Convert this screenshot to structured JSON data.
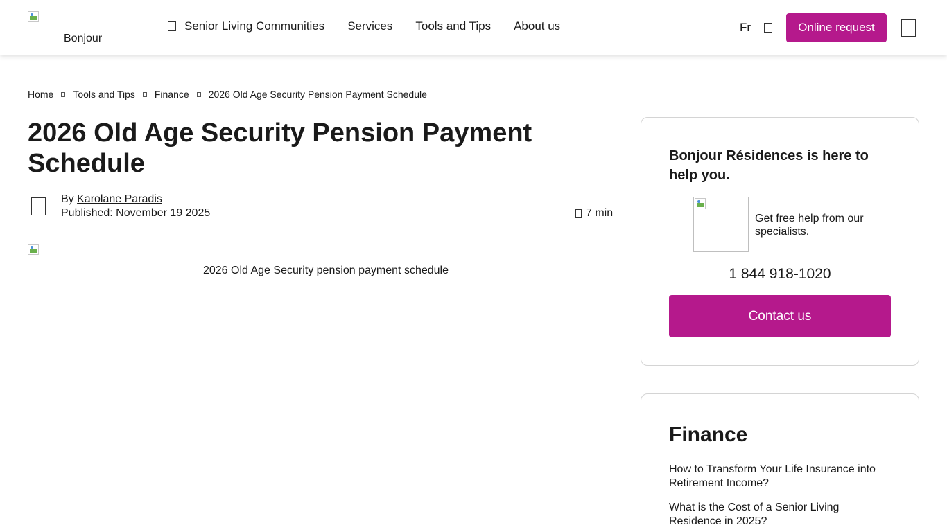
{
  "header": {
    "logo_alt": "Bonjour",
    "nav": [
      {
        "label": "Senior Living Communities"
      },
      {
        "label": "Services"
      },
      {
        "label": "Tools and Tips"
      },
      {
        "label": "About us"
      }
    ],
    "language": "Fr",
    "online_request": "Online request",
    "accent_color": "#b5198c"
  },
  "breadcrumb": {
    "items": [
      "Home",
      "Tools and Tips",
      "Finance"
    ],
    "current": "2026 Old Age Security Pension Payment Schedule"
  },
  "article": {
    "title": "2026 Old Age Security Pension Payment Schedule",
    "by_prefix": "By",
    "author": "Karolane Paradis",
    "published": "Published: November 19 2025",
    "read_time": "7 min",
    "hero_alt": "2026 Old Age Security pension payment schedule"
  },
  "help_card": {
    "title": "Bonjour Résidences is here to help you.",
    "text": "Get free help from our specialists.",
    "phone": "1 844 918-1020",
    "contact_label": "Contact us"
  },
  "finance_card": {
    "title": "Finance",
    "links": [
      {
        "label": "How to Transform Your Life Insurance into Retirement Income?"
      },
      {
        "label": "What is the Cost of a Senior Living Residence in 2025?"
      }
    ]
  }
}
